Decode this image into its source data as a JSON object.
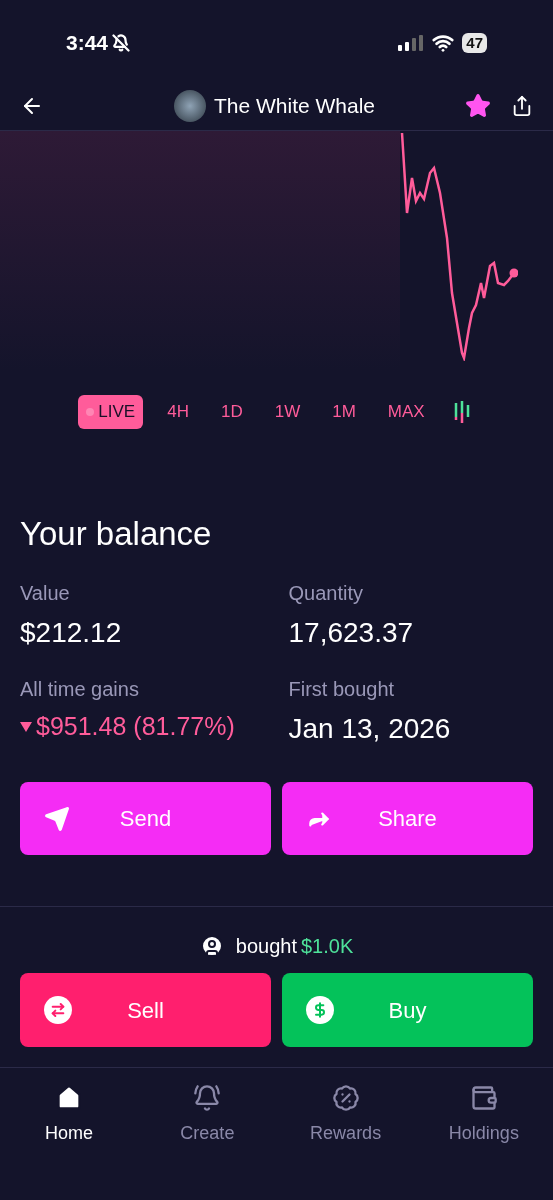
{
  "status_bar": {
    "time": "3:44",
    "battery": "47",
    "silenced": true
  },
  "header": {
    "title": "The White Whale",
    "favorite": true
  },
  "ranges": [
    {
      "label": "LIVE",
      "selected": true,
      "kind": "live"
    },
    {
      "label": "4H",
      "selected": false,
      "kind": "text"
    },
    {
      "label": "1D",
      "selected": false,
      "kind": "text"
    },
    {
      "label": "1W",
      "selected": false,
      "kind": "text"
    },
    {
      "label": "1M",
      "selected": false,
      "kind": "text"
    },
    {
      "label": "MAX",
      "selected": false,
      "kind": "text"
    },
    {
      "kind": "candles"
    }
  ],
  "balance": {
    "title": "Your balance",
    "stats": [
      {
        "label": "Value",
        "value": "$212.12",
        "kind": "plain"
      },
      {
        "label": "Quantity",
        "value": "17,623.37",
        "kind": "plain"
      },
      {
        "label": "All time gains",
        "value": "$951.48 (81.77%)",
        "kind": "loss"
      },
      {
        "label": "First bought",
        "value": "Jan 13, 2026",
        "kind": "plain"
      }
    ]
  },
  "actions": [
    {
      "label": "Send",
      "kind": "send"
    },
    {
      "label": "Share",
      "kind": "share"
    }
  ],
  "activity": {
    "text": "bought",
    "amount": "$1.0K"
  },
  "trade": [
    {
      "label": "Sell",
      "kind": "sell"
    },
    {
      "label": "Buy",
      "kind": "buy"
    }
  ],
  "nav": [
    {
      "label": "Home",
      "selected": true,
      "kind": "home"
    },
    {
      "label": "Create",
      "selected": false,
      "kind": "create"
    },
    {
      "label": "Rewards",
      "selected": false,
      "kind": "rewards"
    },
    {
      "label": "Holdings",
      "selected": false,
      "kind": "holdings"
    }
  ]
}
